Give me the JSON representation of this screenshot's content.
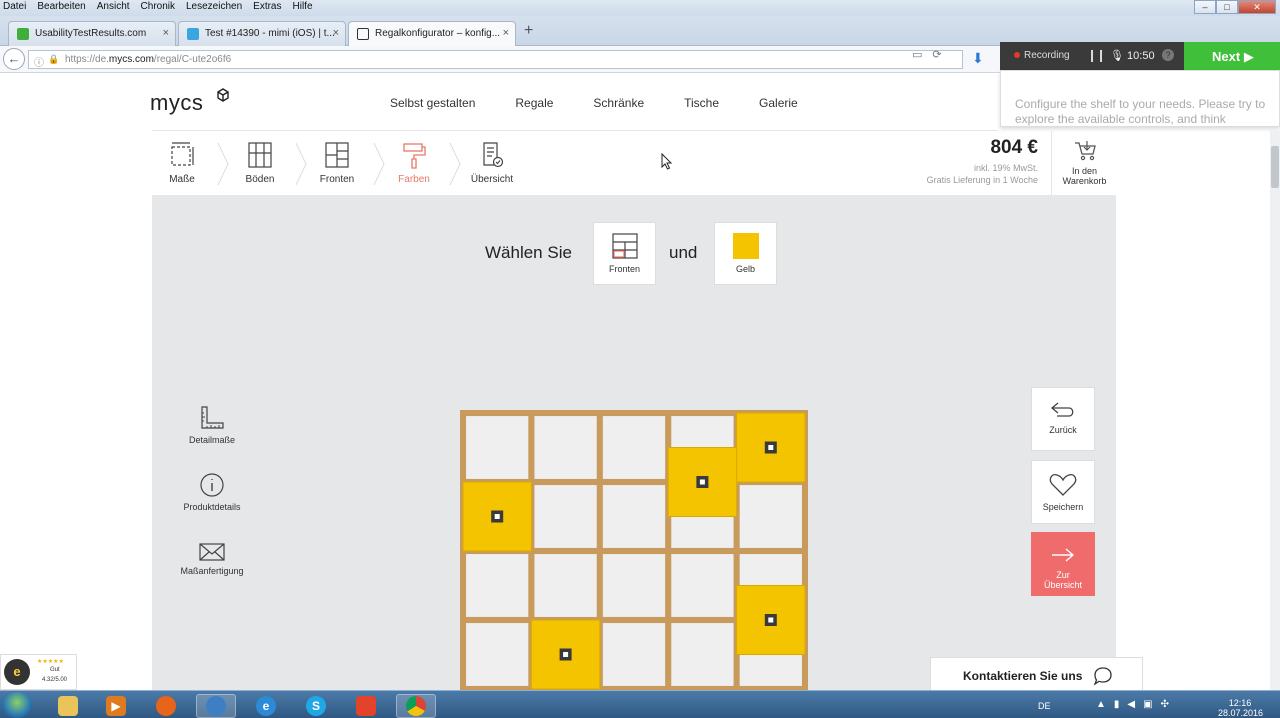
{
  "browser": {
    "menu": [
      "Datei",
      "Bearbeiten",
      "Ansicht",
      "Chronik",
      "Lesezeichen",
      "Extras",
      "Hilfe"
    ],
    "tabs": [
      {
        "label": "UsabilityTestResults.com",
        "close": "×"
      },
      {
        "label": "Test #14390 - mimi (iOS) | t...",
        "close": "×"
      },
      {
        "label": "Regalkonfigurator – konfig...",
        "close": "×"
      }
    ],
    "new_tab": "+",
    "url_prefix": "https://de.",
    "url_host": "mycs.com",
    "url_path": "/regal/C-ute2o6f6"
  },
  "recorder": {
    "status": "Recording",
    "time": "10:50",
    "help": "?",
    "next_label": "Next",
    "task_text": "Configure the shelf to your needs. Please try to explore the available controls, and think"
  },
  "site": {
    "logo": "mycs",
    "nav": [
      "Selbst gestalten",
      "Regale",
      "Schränke",
      "Tische",
      "Galerie"
    ],
    "steps": [
      {
        "label": "Maße"
      },
      {
        "label": "Böden"
      },
      {
        "label": "Fronten"
      },
      {
        "label": "Farben"
      },
      {
        "label": "Übersicht"
      }
    ],
    "price": "804 €",
    "price_tax": "inkl. 19% MwSt.",
    "price_delivery": "Gratis Lieferung in 1 Woche",
    "cart_label_1": "In den",
    "cart_label_2": "Warenkorb",
    "choose_text": "Wählen Sie",
    "and_text": "und",
    "chip_fronts": "Fronten",
    "chip_color": "Gelb",
    "side_tools": [
      "Detailmaße",
      "Produktdetails",
      "Maßanfertigung"
    ],
    "btn_back": "Zurück",
    "btn_save": "Speichern",
    "btn_overview_1": "Zur",
    "btn_overview_2": "Übersicht",
    "contact": "Kontaktieren Sie uns",
    "trust_seal": "e",
    "trust_rating": "Gut",
    "trust_score": "4.32/5.00",
    "trust_stars": "★★★★★"
  },
  "shelf": {
    "columns": 5,
    "rows": 4,
    "yellow_fronts": [
      {
        "col": 4,
        "row": 0
      },
      {
        "col": 3,
        "row": 0.5
      },
      {
        "col": 0,
        "row": 1
      },
      {
        "col": 4,
        "row": 2.5
      },
      {
        "col": 1,
        "row": 3
      }
    ]
  },
  "colors": {
    "accent": "#e8786a",
    "primary_button": "#f06b6b",
    "yellow": "#f5c400",
    "wood": "#c89a5b",
    "next_green": "#3fbf3a"
  },
  "taskbar": {
    "lang": "DE",
    "time": "12:16",
    "date": "28.07.2016"
  }
}
